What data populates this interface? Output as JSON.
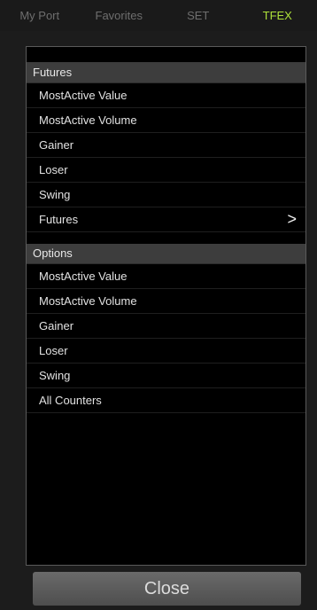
{
  "tabs": [
    {
      "label": "My Port",
      "active": false
    },
    {
      "label": "Favorites",
      "active": false
    },
    {
      "label": "SET",
      "active": false
    },
    {
      "label": "TFEX",
      "active": true
    }
  ],
  "futures": {
    "title": "Futures",
    "items": [
      {
        "label": "MostActive Value"
      },
      {
        "label": "MostActive Volume"
      },
      {
        "label": "Gainer"
      },
      {
        "label": "Loser"
      },
      {
        "label": "Swing"
      },
      {
        "label": "Futures",
        "chevron": ">"
      }
    ]
  },
  "options": {
    "title": "Options",
    "items": [
      {
        "label": "MostActive Value"
      },
      {
        "label": "MostActive Volume"
      },
      {
        "label": "Gainer"
      },
      {
        "label": "Loser"
      },
      {
        "label": "Swing"
      },
      {
        "label": "All Counters"
      }
    ]
  },
  "close_label": "Close",
  "colors": {
    "accent": "#aee23a",
    "tab_inactive": "#6e6e6e",
    "header_bg": "#3d3d3d"
  }
}
